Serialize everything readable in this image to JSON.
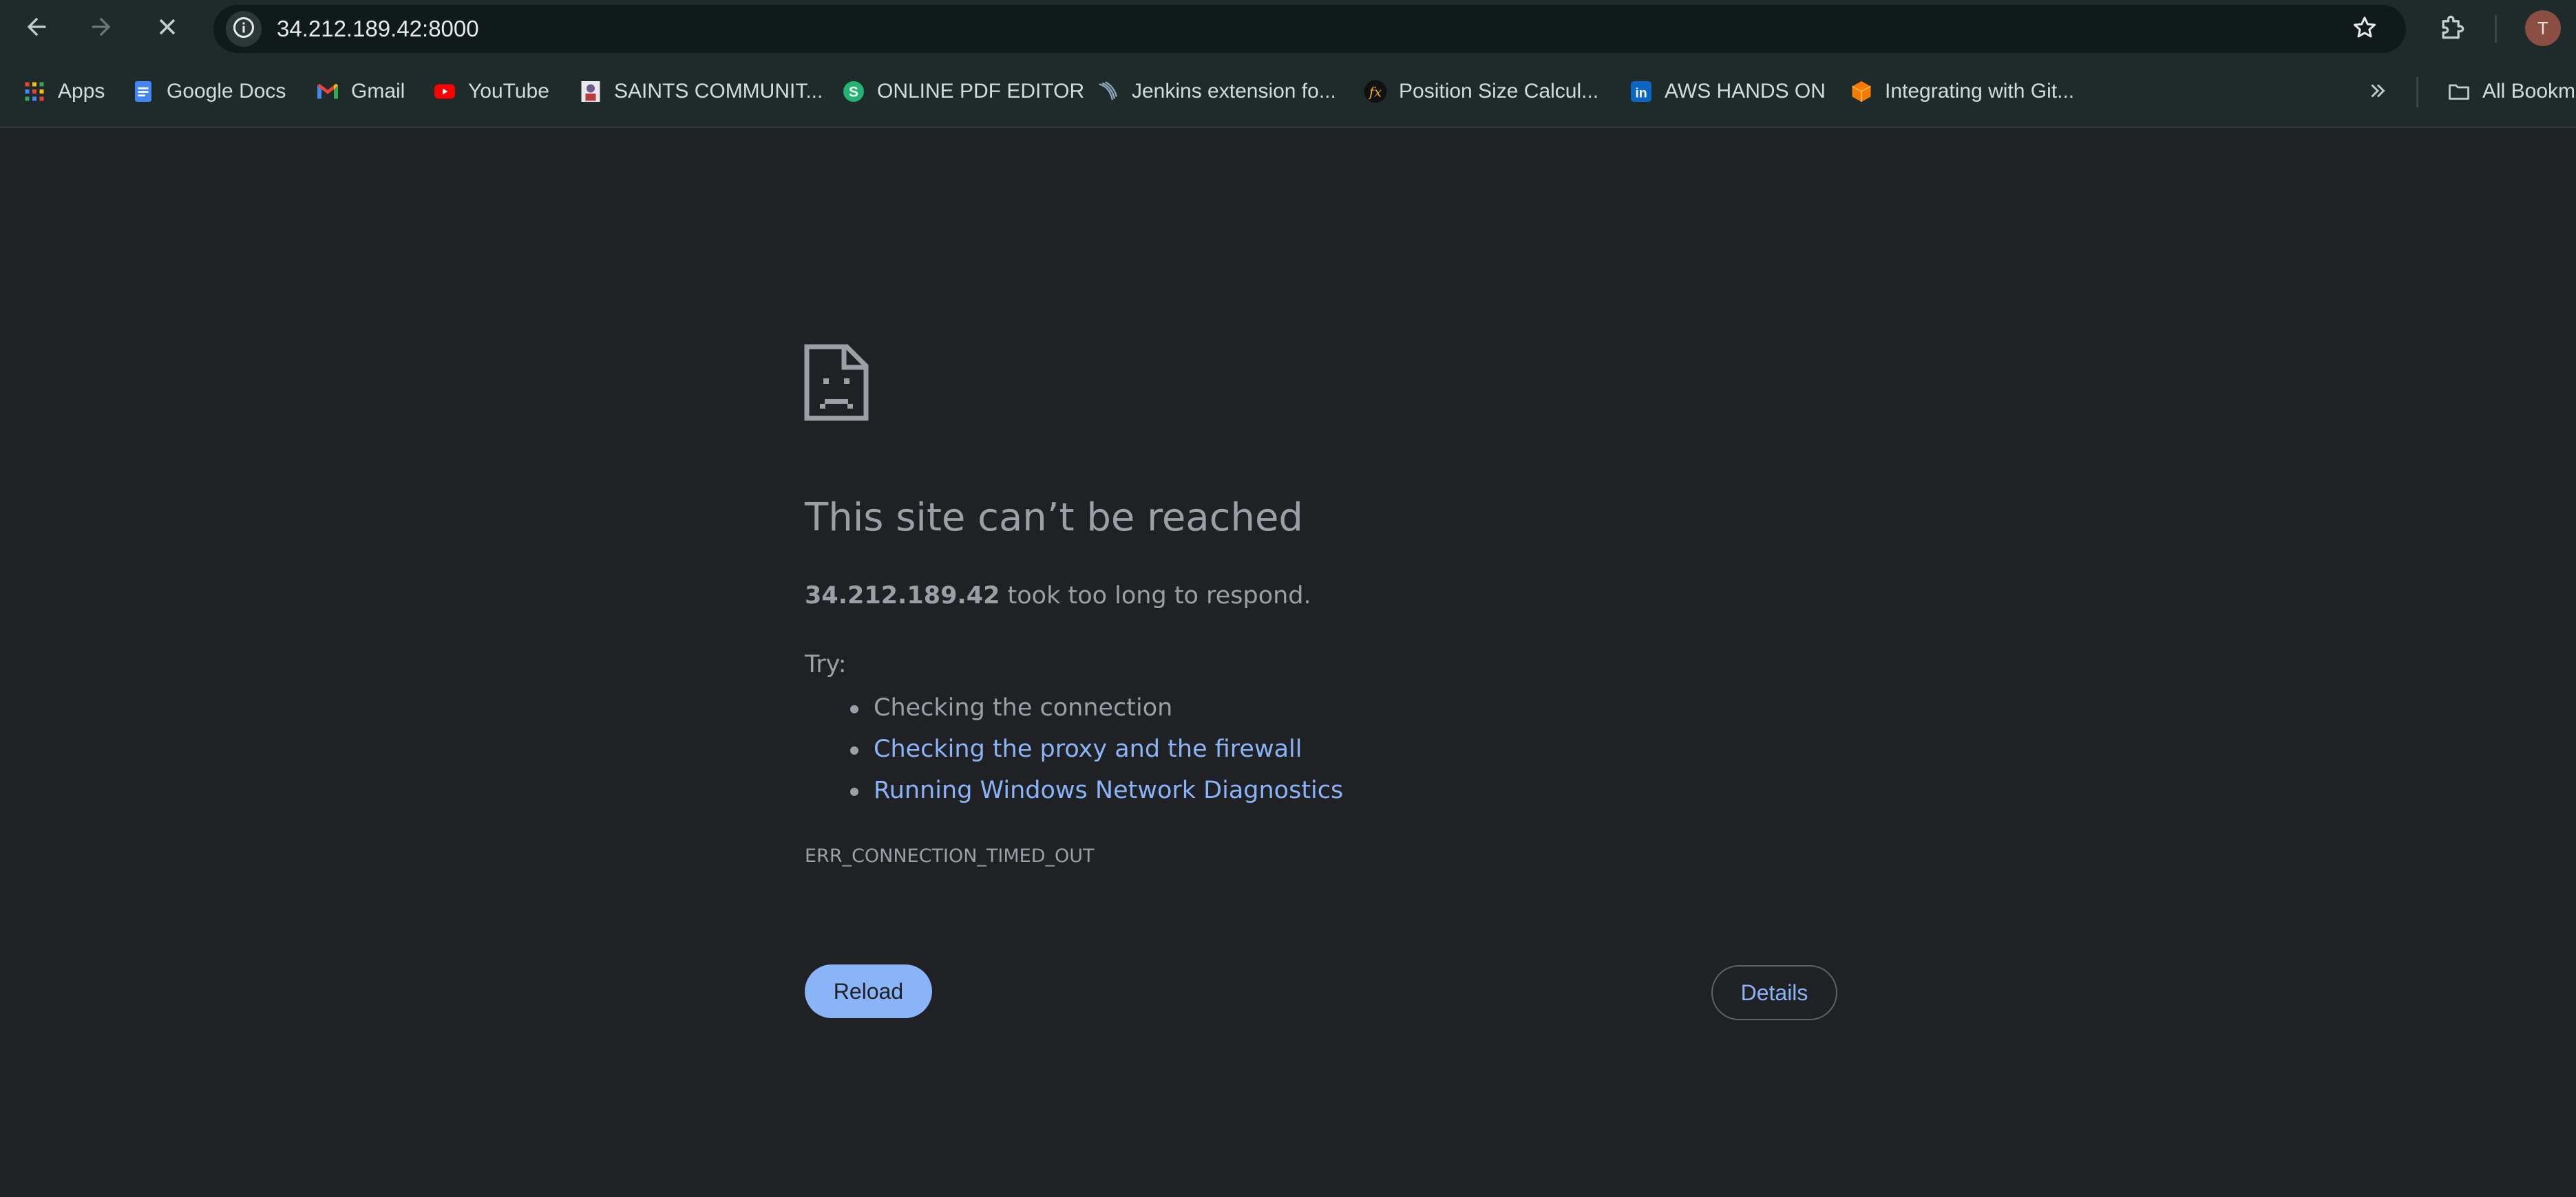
{
  "browser": {
    "url": "34.212.189.42:8000",
    "avatar_initial": "T",
    "icons": {
      "back": "arrow-left-icon",
      "forward": "arrow-right-icon",
      "stop": "close-icon",
      "site_info": "info-icon",
      "bookmark_star": "star-icon",
      "extensions": "puzzle-icon",
      "more_bookmarks": "double-chevron-right-icon",
      "all_bookmarks": "folder-icon"
    },
    "colors": {
      "toolbar_bg": "#1f2b2b",
      "omnibox_bg": "#101a1b",
      "avatar_bg": "#8a4e42"
    }
  },
  "bookmarks": {
    "items": [
      {
        "label": "Apps",
        "icon": "apps-grid-icon"
      },
      {
        "label": "Google Docs",
        "icon": "google-docs-icon"
      },
      {
        "label": "Gmail",
        "icon": "gmail-icon"
      },
      {
        "label": "YouTube",
        "icon": "youtube-icon"
      },
      {
        "label": "SAINTS COMMUNIT...",
        "icon": "saints-community-icon"
      },
      {
        "label": "ONLINE PDF EDITOR",
        "icon": "pdf-editor-icon"
      },
      {
        "label": "Jenkins extension fo...",
        "icon": "jenkins-extension-icon"
      },
      {
        "label": "Position Size Calcul...",
        "icon": "fx-icon"
      },
      {
        "label": "AWS HANDS ON",
        "icon": "linkedin-icon"
      },
      {
        "label": "Integrating with Git...",
        "icon": "cube-icon"
      }
    ],
    "all_bookmarks_label": "All Bookm"
  },
  "error_page": {
    "title": "This site can’t be reached",
    "host": "34.212.189.42",
    "summary_suffix": " took too long to respond.",
    "try_label": "Try:",
    "suggestions": [
      {
        "text": "Checking the connection",
        "is_link": false
      },
      {
        "text": "Checking the proxy and the firewall",
        "is_link": true
      },
      {
        "text": "Running Windows Network Diagnostics",
        "is_link": true
      }
    ],
    "error_code": "ERR_CONNECTION_TIMED_OUT",
    "reload_label": "Reload",
    "details_label": "Details",
    "icon": "sad-page-icon",
    "colors": {
      "page_bg": "#202124",
      "text": "#9aa0a6",
      "link": "#8ab4f8",
      "primary_button": "#8ab4f8"
    }
  }
}
